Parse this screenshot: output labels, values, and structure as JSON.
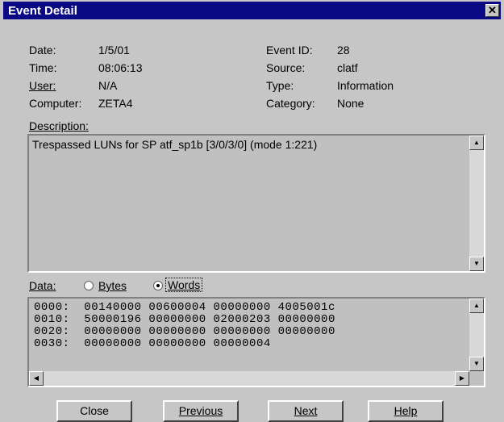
{
  "window": {
    "title": "Event Detail",
    "close_glyph": "✕"
  },
  "fields": {
    "date_label": "Date:",
    "date_value": "1/5/01",
    "time_label": "Time:",
    "time_value": "08:06:13",
    "user_label": "User:",
    "user_value": "N/A",
    "computer_label": "Computer:",
    "computer_value": "ZETA4",
    "event_id_label": "Event ID:",
    "event_id_value": "28",
    "source_label": "Source:",
    "source_value": "clatf",
    "type_label": "Type:",
    "type_value": "Information",
    "category_label": "Category:",
    "category_value": "None"
  },
  "description": {
    "label": "Description:",
    "text": "Trespassed LUNs for SP atf_sp1b [3/0/3/0] (mode 1:221)"
  },
  "data": {
    "label": "Data:",
    "options": [
      "Bytes",
      "Words"
    ],
    "selected": "Words",
    "rows": [
      "0000:  00140000 00600004 00000000 4005001c",
      "0010:  50000196 00000000 02000203 00000000",
      "0020:  00000000 00000000 00000000 00000000",
      "0030:  00000000 00000000 00000004"
    ]
  },
  "scroll_glyphs": {
    "up": "▲",
    "down": "▼",
    "left": "◀",
    "right": "▶"
  },
  "buttons": {
    "close": "Close",
    "previous": "Previous",
    "next": "Next",
    "help": "Help"
  }
}
